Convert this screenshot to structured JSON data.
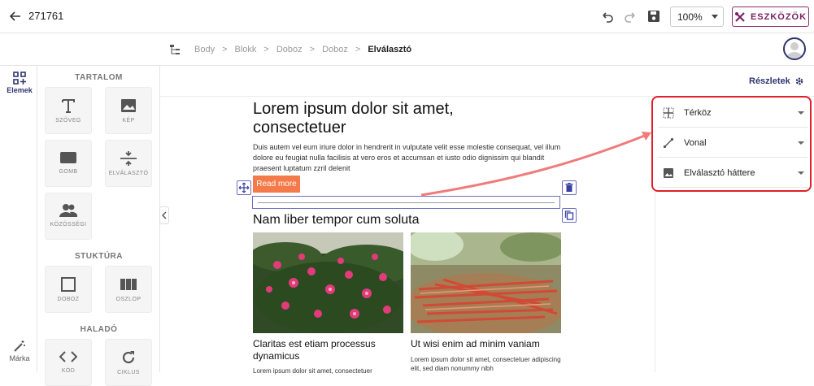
{
  "header": {
    "doc_id": "271761",
    "zoom": "100%",
    "tools_label": "ESZKÖZÖK"
  },
  "breadcrumb": [
    "Body",
    "Blokk",
    "Doboz",
    "Doboz",
    "Elválasztó"
  ],
  "left_rail": {
    "elements_label": "Elemek",
    "brand_label": "Márka"
  },
  "panel": {
    "content_title": "TARTALOM",
    "content_tiles": [
      "SZÖVEG",
      "KÉP",
      "GOMB",
      "ELVÁLASZTÓ",
      "KÖZÖSSÉGI"
    ],
    "structure_title": "STUKTÚRA",
    "structure_tiles": [
      "DOBOZ",
      "OSZLOP"
    ],
    "advanced_title": "HALADÓ",
    "advanced_tiles": [
      "KÓD",
      "CIKLUS"
    ]
  },
  "details_label": "Részletek",
  "properties": [
    "Térköz",
    "Vonal",
    "Elválasztó háttere"
  ],
  "content": {
    "heading": "Lorem ipsum dolor sit amet, consectetuer",
    "paragraph": "Duis autem vel eum iriure dolor in hendrerit in vulputate velit esse molestie consequat, vel illum dolore eu feugiat nulla facilisis at vero eros et accumsan et iusto odio dignissim qui blandit praesent luptatum zzril delenit",
    "button": "Read more",
    "subheading": "Nam liber tempor cum soluta",
    "card1_title": "Claritas est etiam processus dynamicus",
    "card1_text": "Lorem ipsum dolor sit amet, consectetuer",
    "card2_title": "Ut wisi enim ad minim vaniam",
    "card2_text": "Lorem ipsum dolor sit amet, consectetuer adipiscing elit, sed diam nonummy nibh"
  },
  "colors": {
    "accent": "#2e3570",
    "tools": "#7a2165",
    "highlight": "#e0202a",
    "arrow": "#f07b7b",
    "button": "#f47a4a"
  }
}
